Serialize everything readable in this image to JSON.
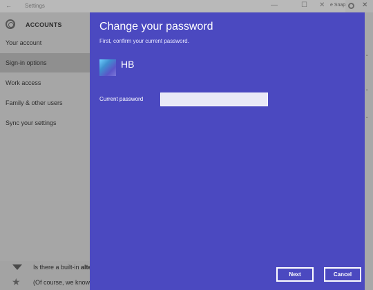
{
  "window": {
    "title": "Settings",
    "back_glyph": "←",
    "minimize_glyph": "—",
    "maximize_glyph": "☐",
    "close_glyph": "✕"
  },
  "browser": {
    "snap_text": "e Snapp",
    "close_glyph": "✕"
  },
  "sidebar": {
    "header": "ACCOUNTS",
    "header_icon": "gear-icon",
    "items": [
      {
        "label": "Your account",
        "active": false
      },
      {
        "label": "Sign-in options",
        "active": true
      },
      {
        "label": "Work access",
        "active": false
      },
      {
        "label": "Family & other users",
        "active": false
      },
      {
        "label": "Sync your settings",
        "active": false
      }
    ]
  },
  "background_page": {
    "line1_prefix": "Is there a built-in ",
    "line1_bold": "alte",
    "line2": "(Of course, we know"
  },
  "dialog": {
    "title": "Change your password",
    "subtitle": "First, confirm your current password.",
    "user_initials": "HB",
    "password_label": "Current password",
    "password_value": "",
    "password_placeholder": "",
    "next_label": "Next",
    "cancel_label": "Cancel",
    "accent_color": "#4b49c0"
  }
}
